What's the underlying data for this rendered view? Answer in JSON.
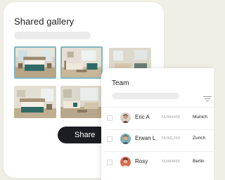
{
  "gallery": {
    "title": "Shared gallery",
    "share_label": "Share",
    "photos": [
      {
        "name": "bedroom-photo-1",
        "selected": true
      },
      {
        "name": "living-room-photo-1",
        "selected": true
      },
      {
        "name": "living-room-photo-2",
        "selected": false
      },
      {
        "name": "bedroom-photo-2",
        "selected": false
      },
      {
        "name": "living-room-photo-3",
        "selected": false
      }
    ]
  },
  "team": {
    "title": "Team",
    "members": [
      {
        "name": "Eric A",
        "num": "NUM4409",
        "city": "Munich"
      },
      {
        "name": "Erwan L",
        "num": "NUM1269",
        "city": "Zurich"
      },
      {
        "name": "Rosy",
        "num": "NUM4865",
        "city": "Berlin"
      }
    ]
  },
  "colors": {
    "background": "#f0efe6",
    "card": "#ffffff",
    "button": "#1b1d22",
    "selection": "#7fb7bd",
    "placeholder": "#ebebeb"
  }
}
